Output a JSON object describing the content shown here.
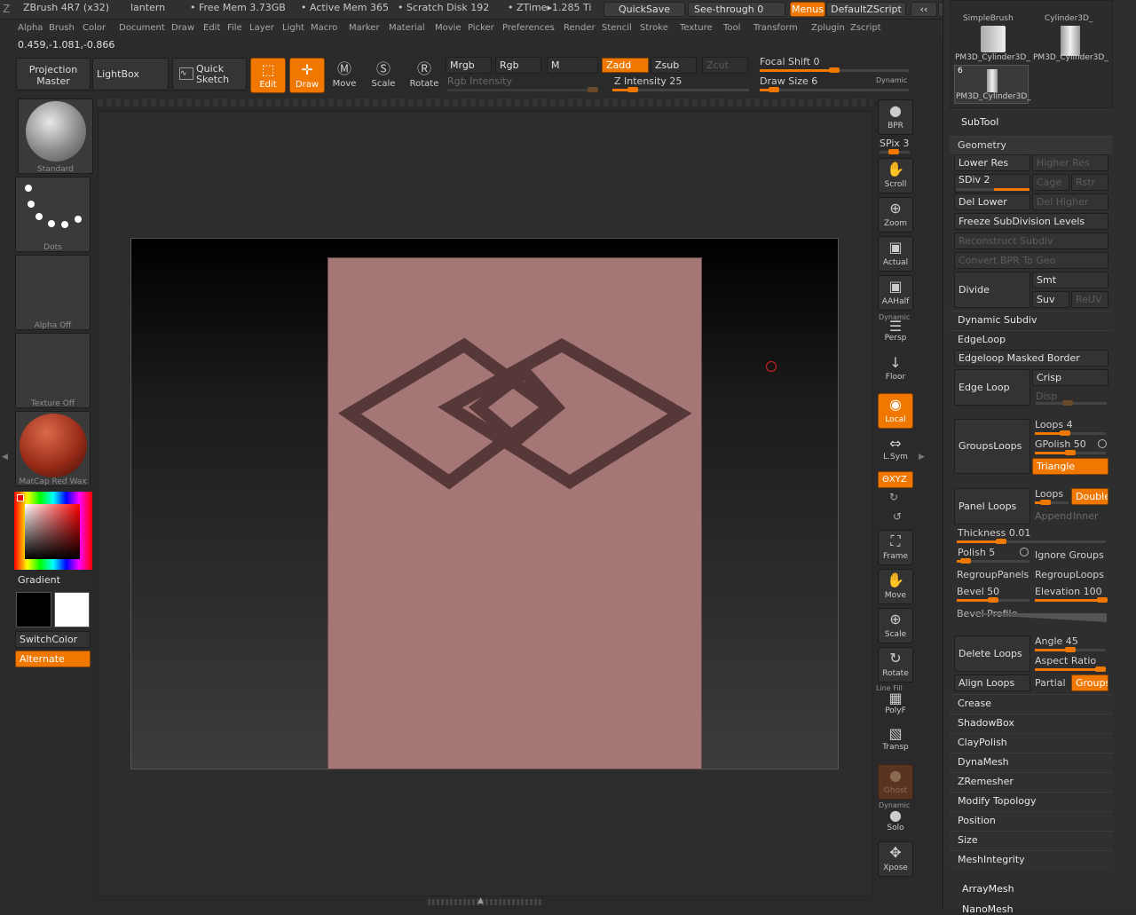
{
  "titlebar": {
    "app": "ZBrush 4R7 (x32)",
    "doc": "lantern",
    "free_mem": "• Free Mem 3.73GB",
    "active_mem": "• Active Mem 365",
    "scratch": "• Scratch Disk 192",
    "ztime": "• ZTime▸1.285 Ti",
    "quicksave": "QuickSave",
    "see_through": "See-through  0",
    "menus": "Menus",
    "default_zscript": "DefaultZScript"
  },
  "menubar": [
    "Alpha",
    "Brush",
    "Color",
    "Document",
    "Draw",
    "Edit",
    "File",
    "Layer",
    "Light",
    "Macro",
    "Marker",
    "Material",
    "Movie",
    "Picker",
    "Preferences",
    "Render",
    "Stencil",
    "Stroke",
    "Texture",
    "Tool",
    "Transform",
    "Zplugin",
    "Zscript"
  ],
  "coords": "0.459,-1.081,-0.866",
  "toolbar": {
    "projection_master": "Projection Master",
    "lightbox": "LightBox",
    "quick_sketch": "Quick Sketch",
    "edit": "Edit",
    "draw": "Draw",
    "move": "Move",
    "scale": "Scale",
    "rotate": "Rotate",
    "mrgb": "Mrgb",
    "rgb": "Rgb",
    "m": "M",
    "zadd": "Zadd",
    "zsub": "Zsub",
    "zcut": "Zcut",
    "rgb_intensity": "Rgb Intensity",
    "z_intensity": "Z Intensity 25",
    "focal_shift": "Focal Shift 0",
    "draw_size": "Draw Size 6",
    "dynamic": "Dynamic",
    "z_intensity_value": 25,
    "focal_shift_value": 0,
    "draw_size_value": 6
  },
  "left": {
    "brush": "Standard",
    "stroke": "Dots",
    "alpha": "Alpha Off",
    "texture": "Texture Off",
    "material": "MatCap Red Wax",
    "gradient": "Gradient",
    "switchcolor": "SwitchColor",
    "alternate": "Alternate",
    "primary_color": "#000000",
    "secondary_color": "#ffffff"
  },
  "right": {
    "bpr": "BPR",
    "spix": "SPix 3",
    "scroll": "Scroll",
    "zoom": "Zoom",
    "actual": "Actual",
    "aahalf": "AAHalf",
    "dynamic": "Dynamic",
    "persp": "Persp",
    "floor": "Floor",
    "local": "Local",
    "lsym": "L.Sym",
    "xyz": "ΘXYZ",
    "frame": "Frame",
    "move": "Move",
    "scale": "Scale",
    "rotate": "Rotate",
    "line_fill": "Line Fill",
    "polyf": "PolyF",
    "transp": "Transp",
    "ghost": "Ghost",
    "dynamic2": "Dynamic",
    "solo": "Solo",
    "xpose": "Xpose"
  },
  "tray": {
    "thumbs": [
      "SimpleBrush",
      "Cylinder3D_",
      "PM3D_Cylinder3D_",
      "PM3D_Cylinder3D_",
      "PM3D_Cylinder3D_"
    ],
    "thumb_count": "6",
    "subtool": "SubTool",
    "geometry": "Geometry",
    "lower_res": "Lower Res",
    "higher_res": "Higher Res",
    "sdiv": "SDiv 2",
    "cage": "Cage",
    "rstr": "Rstr",
    "del_lower": "Del Lower",
    "del_higher": "Del Higher",
    "freeze": "Freeze SubDivision Levels",
    "reconstruct": "Reconstruct Subdiv",
    "convert_bpr": "Convert BPR To Geo",
    "divide": "Divide",
    "smt": "Smt",
    "suv": "Suv",
    "reuv": "ReUV",
    "dynamic_subdiv": "Dynamic Subdiv",
    "edgeloop": "EdgeLoop",
    "edgeloop_masked": "Edgeloop Masked Border",
    "edge_loop": "Edge Loop",
    "crisp": "Crisp",
    "disp": "Disp",
    "groupsloops": "GroupsLoops",
    "loops4": "Loops 4",
    "gpolish": "GPolish 50",
    "triangle": "Triangle",
    "panel_loops": "Panel Loops",
    "loops": "Loops",
    "double": "Double",
    "append": "Append",
    "inner": "Inner",
    "thickness": "Thickness 0.01",
    "polish": "Polish 5",
    "ignore_groups": "Ignore Groups",
    "regroup_panels": "RegroupPanels",
    "regroup_loops": "RegroupLoops",
    "bevel": "Bevel 50",
    "elevation": "Elevation 100",
    "bevel_profile": "Bevel Profile",
    "delete_loops": "Delete Loops",
    "angle": "Angle 45",
    "aspect_ratio": "Aspect Ratio",
    "align_loops": "Align Loops",
    "partial": "Partial",
    "groups": "Groups",
    "sections": [
      "Crease",
      "ShadowBox",
      "ClayPolish",
      "DynaMesh",
      "ZRemesher",
      "Modify Topology",
      "Position",
      "Size",
      "MeshIntegrity"
    ],
    "arraymesh": "ArrayMesh",
    "nanomesh": "NanoMesh"
  }
}
